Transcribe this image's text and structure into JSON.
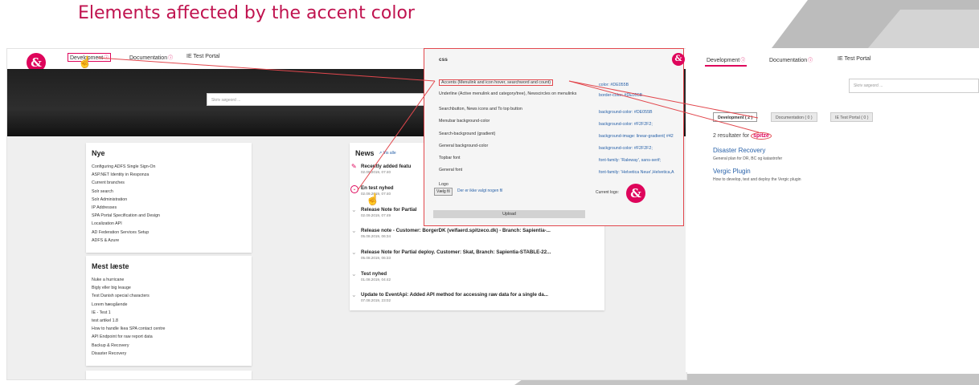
{
  "slide": {
    "title": "Elements affected by the accent color"
  },
  "colors": {
    "accent": "#DE055B",
    "callout": "#E2474D",
    "link": "#2962A9"
  },
  "brand": {
    "logo_glyph": "&"
  },
  "topbar": {
    "nav": [
      {
        "label": "Development",
        "sup": "ⓘ",
        "active": true
      },
      {
        "label": "Documentation",
        "sup": "ⓘ"
      },
      {
        "label": "IE Test Portal",
        "sup": ""
      }
    ]
  },
  "hero": {
    "search_placeholder": "Skriv søgeord ..."
  },
  "nye": {
    "title": "Nye",
    "items": [
      "Configuring ADFS Single Sign-On",
      "ASP.NET Identity in Responza",
      "Current branches",
      "Solr search",
      "Solr Administration",
      "IP Addresses",
      "SPA Portal Specification and Design",
      "Localization API",
      "AD Federation Services Setup",
      "ADFS & Azure"
    ]
  },
  "mest": {
    "title": "Mest læste",
    "items": [
      "Nuke a hurricane",
      "Bigly eller big leauge",
      "Test Danish special characters",
      "Lorem hæsgående",
      "IE - Test 1",
      "test artikel 1.8",
      "How to handle Ikea SPA contact centre",
      "API Endpoint for raw report data",
      "Backup & Recovery",
      "Disaster Recovery"
    ]
  },
  "news": {
    "title": "News",
    "see_all": "Vis alle",
    "items": [
      {
        "title": "Recently added featu",
        "date": "02.09.2019, 07:40",
        "icon": "pin-icon"
      },
      {
        "title": "En test nyhed",
        "date": "02.09.2019, 07:40",
        "icon": "chevron-circle-icon"
      },
      {
        "title": "Release Note for Partial",
        "date": "02.09.2019, 07:49",
        "icon": "chevron-icon"
      },
      {
        "title": "Release note - Customer: BorgerDK (velfaerd.spitzeco.dk) - Branch: Sapientia-...",
        "date": "05.08.2019, 06:34",
        "icon": "chevron-icon"
      },
      {
        "title": "Release Note for Partial deploy. Customer: Skat, Branch: Sapientia-STABLE-22...",
        "date": "05.08.2019, 06:33",
        "icon": "chevron-icon"
      },
      {
        "title": "Test nyhed",
        "date": "01.08.2019, 04:42",
        "icon": "chevron-icon"
      },
      {
        "title": "Update to EventApi: Added API method for accessing raw data for a single da...",
        "date": "07.08.2019, 23:02",
        "icon": "chevron-icon"
      }
    ]
  },
  "css_panel": {
    "title": "css",
    "rows": [
      {
        "label": "Accents (Menulink and icon hover, searchword and count)",
        "value": "color: #DE055B",
        "value2": "border-color: #DE055B"
      },
      {
        "label": "Underline (Active menulink and category/tree), Newscircles on menulinks",
        "value": ""
      },
      {
        "label": "Searchbutton, News icons and To top button",
        "value": "background-color: #DE055B"
      },
      {
        "label": "Menubar background-color",
        "value": "background-color: #F2F2F2;"
      },
      {
        "label": "Search-background (gradient)",
        "value": "background-image: linear-gradient( #42"
      },
      {
        "label": "General background-color",
        "value": "background-color: #F2F2F2;"
      },
      {
        "label": "Topbar font",
        "value": "font-family: 'Raleway', sans-serif;"
      },
      {
        "label": "General font",
        "value": "font-family: 'Helvetica Neue',Helvetica,A"
      }
    ],
    "logo_label": "Logo",
    "file_button": "Vælg fil",
    "file_status": "Der er ikke valgt nogen fil",
    "current_logo_label": "Current logo:",
    "upload": "Upload"
  },
  "right": {
    "nav": [
      {
        "label": "Development",
        "sup": "ⓘ",
        "active": true
      },
      {
        "label": "Documentation",
        "sup": "ⓘ"
      },
      {
        "label": "IE Test Portal",
        "sup": ""
      }
    ],
    "search_placeholder": "Skriv søgeord ...",
    "facets": [
      {
        "label": "Development ( 2 )",
        "selected": true
      },
      {
        "label": "Documentation ( 0 )"
      },
      {
        "label": "IE Test Portal ( 0 )"
      }
    ],
    "result_count_prefix": "2 resultater for",
    "search_term": "spitze",
    "results": [
      {
        "title": "Disaster Recovery",
        "desc": "General plan for DR, BC og katastrofer"
      },
      {
        "title": "Vergic Plugin",
        "desc": "How to develop, test and deploy the Vergic plugin"
      }
    ]
  }
}
